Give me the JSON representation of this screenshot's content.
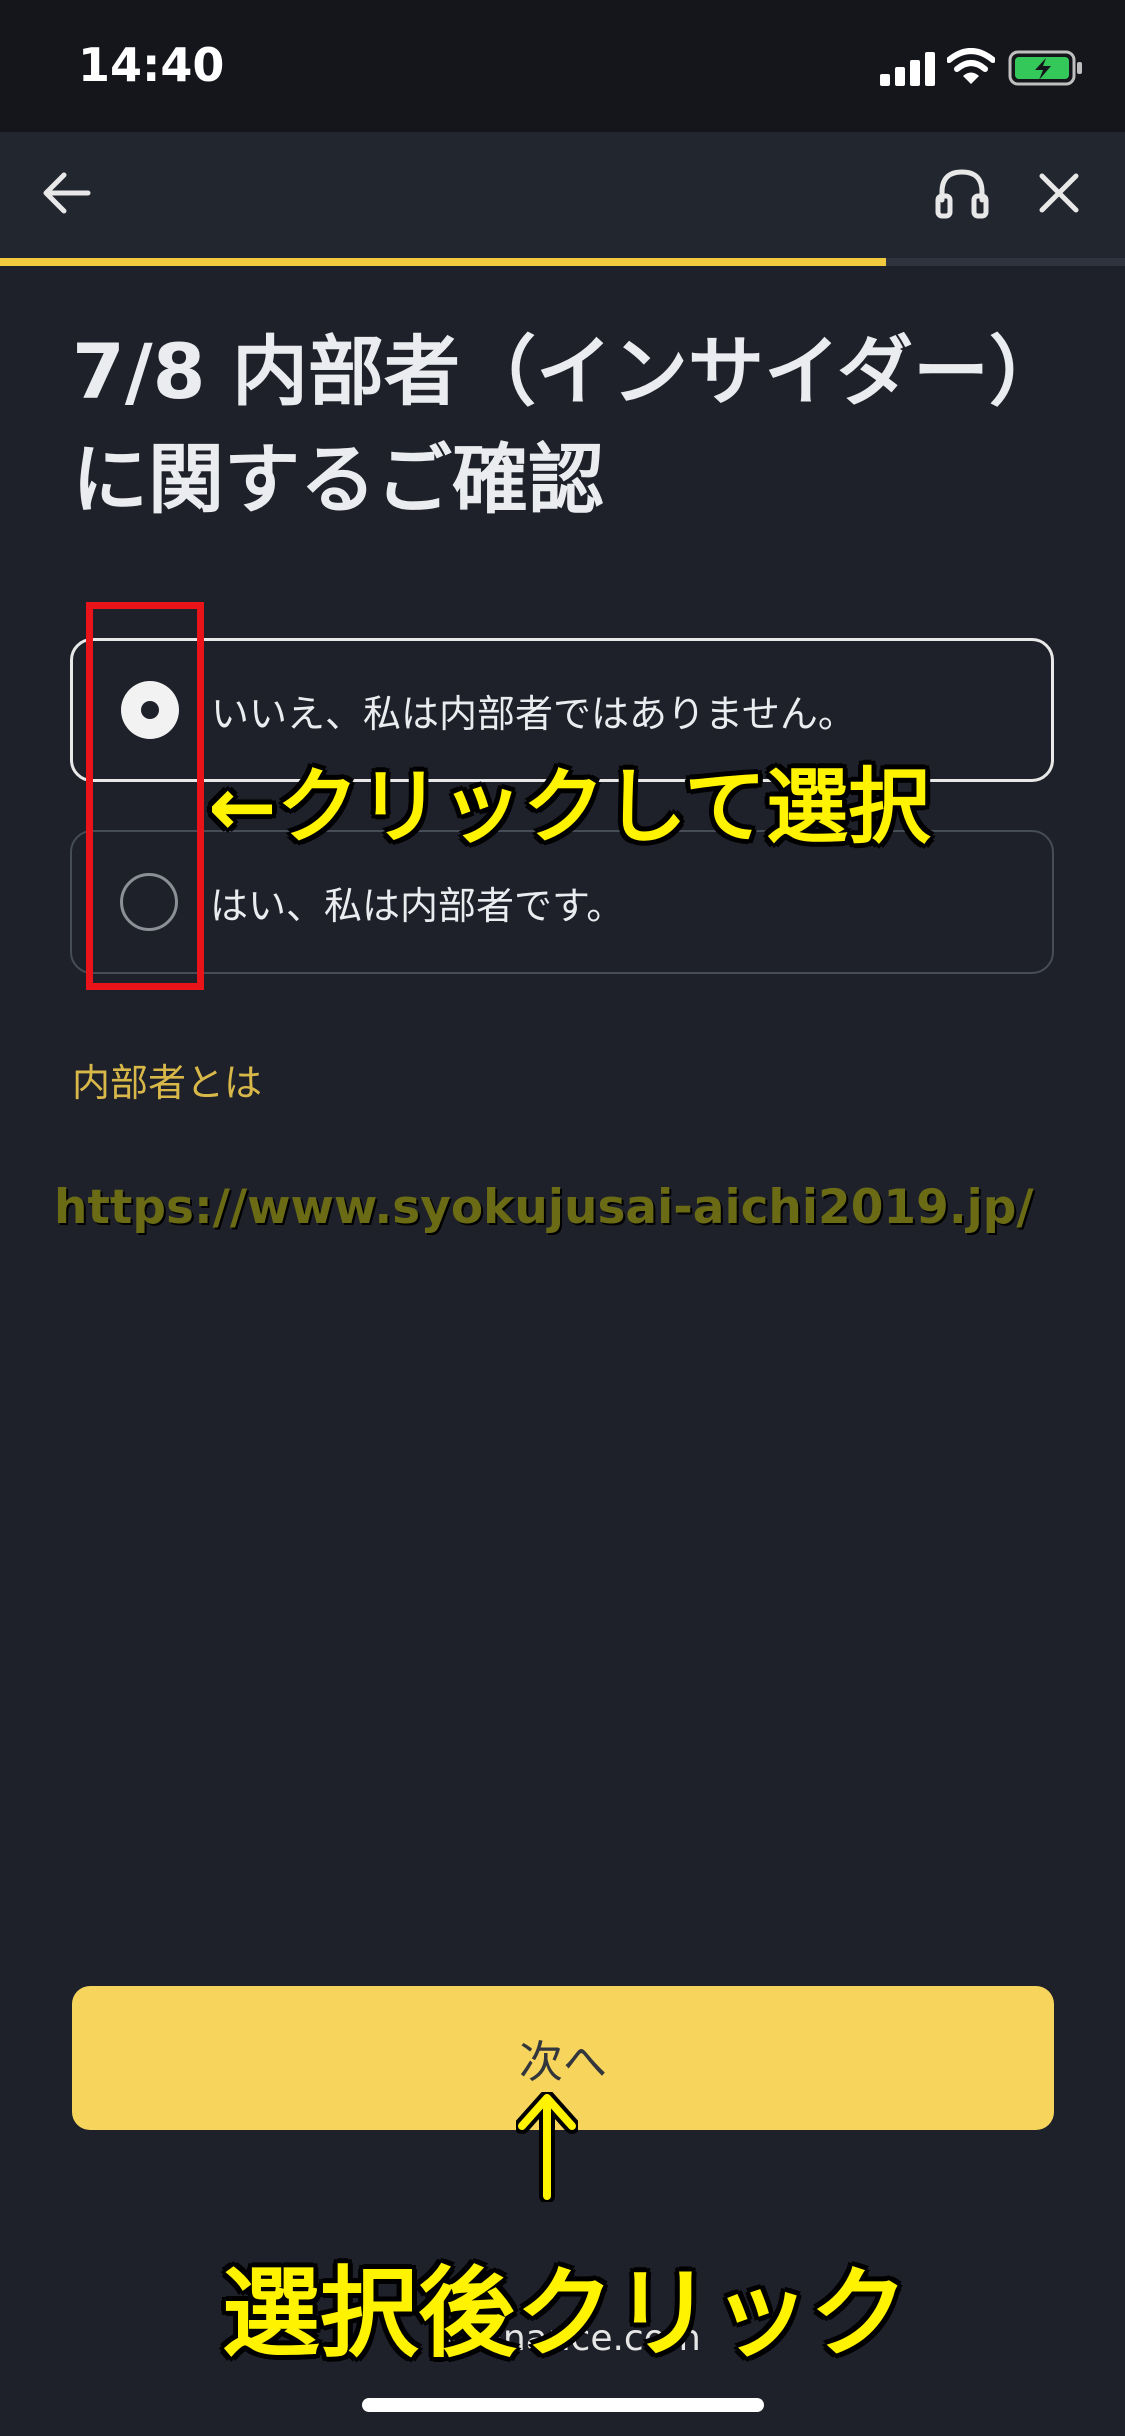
{
  "status_bar": {
    "time": "14:40"
  },
  "header": {
    "back_icon": "arrow-left-icon",
    "support_icon": "headset-icon",
    "close_icon": "close-icon",
    "progress_fraction": 0.875
  },
  "page": {
    "title": "7/8 内部者（インサイダー）に関するご確認"
  },
  "options": [
    {
      "label": "いいえ、私は内部者ではありません。",
      "selected": true
    },
    {
      "label": "はい、私は内部者です。",
      "selected": false
    }
  ],
  "insider_link": "内部者とは",
  "watermark": "https://www.syokujusai-aichi2019.jp/",
  "next_button": "次へ",
  "annotations": {
    "click_select": "←クリックして選択",
    "after_select": "選択後クリック",
    "arrow": "↑",
    "highlight_color": "#e8141a",
    "text_color": "#fff300"
  },
  "browser": {
    "url": "binance.com"
  },
  "colors": {
    "background": "#1e2129",
    "accent": "#f0c93f",
    "button": "#f7d55c"
  }
}
